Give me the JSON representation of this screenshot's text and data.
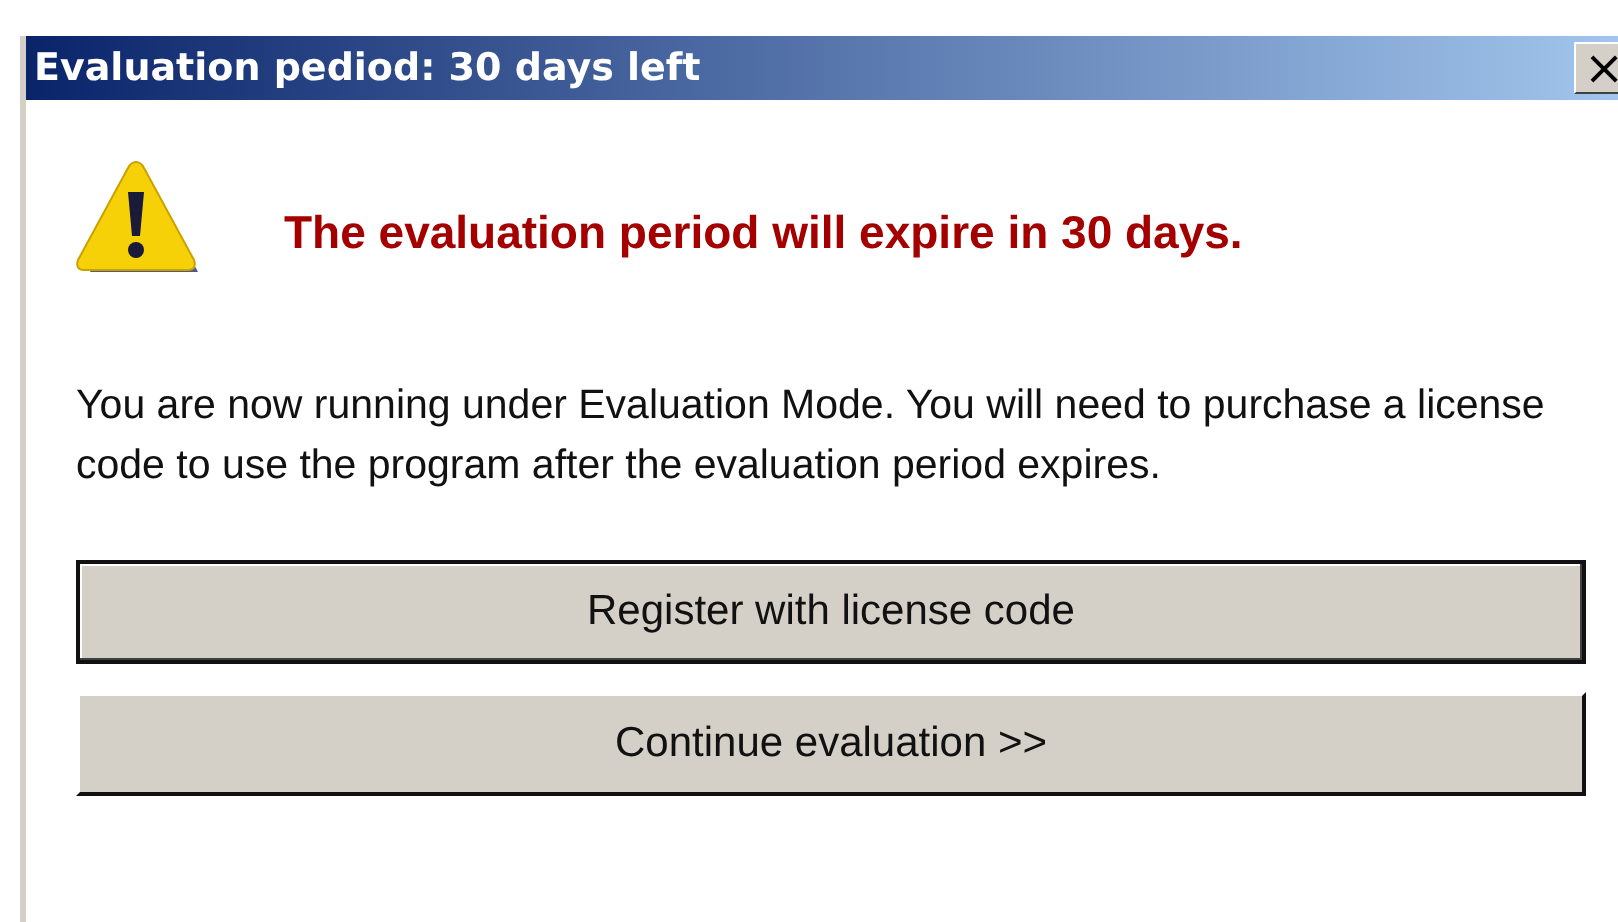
{
  "window": {
    "title": "Evaluation pediod: 30 days left",
    "close": "×"
  },
  "heading": "The evaluation period will expire in 30 days.",
  "message": "You are now running under Evaluation Mode. You will need to purchase a license code to use the program after the evaluation period expires.",
  "buttons": [
    {
      "label": "Register with license code",
      "default": true
    },
    {
      "label": "Continue evaluation >>",
      "default": false
    }
  ]
}
